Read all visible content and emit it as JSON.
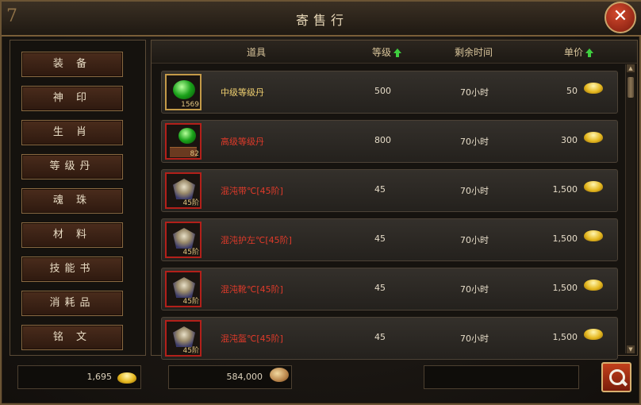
{
  "window": {
    "title": "寄售行",
    "close_glyph": "✕"
  },
  "categories": [
    "装 备",
    "神 印",
    "生 肖",
    "等级丹",
    "魂 珠",
    "材 料",
    "技能书",
    "消耗品",
    "铭 文"
  ],
  "table": {
    "headers": {
      "item": "道具",
      "level": "等级",
      "time": "剩余时间",
      "price": "单价"
    },
    "rows": [
      {
        "name": "中级等级丹",
        "qty": "1569",
        "level": "500",
        "time": "70小时",
        "price": "50",
        "name_color": "#f0d070",
        "icon": "green-gem-icon"
      },
      {
        "name": "高级等级丹",
        "qty": "82",
        "level": "800",
        "time": "70小时",
        "price": "300",
        "name_color": "#e03a2a",
        "icon": "green-gem-box-icon"
      },
      {
        "name": "混沌带℃[45阶]",
        "qty": "45阶",
        "level": "45",
        "time": "70小时",
        "price": "1,500",
        "name_color": "#e03a2a",
        "icon": "belt-armor-icon"
      },
      {
        "name": "混沌护左℃[45阶]",
        "qty": "45阶",
        "level": "45",
        "time": "70小时",
        "price": "1,500",
        "name_color": "#e03a2a",
        "icon": "shoulder-armor-icon"
      },
      {
        "name": "混沌靴℃[45阶]",
        "qty": "45阶",
        "level": "45",
        "time": "70小时",
        "price": "1,500",
        "name_color": "#e03a2a",
        "icon": "boots-armor-icon"
      },
      {
        "name": "混沌盔℃[45阶]",
        "qty": "45阶",
        "level": "45",
        "time": "70小时",
        "price": "1,500",
        "name_color": "#e03a2a",
        "icon": "helmet-armor-icon"
      }
    ]
  },
  "footer": {
    "gold_amount": "1,695",
    "coin_amount": "584,000",
    "search_placeholder": ""
  }
}
